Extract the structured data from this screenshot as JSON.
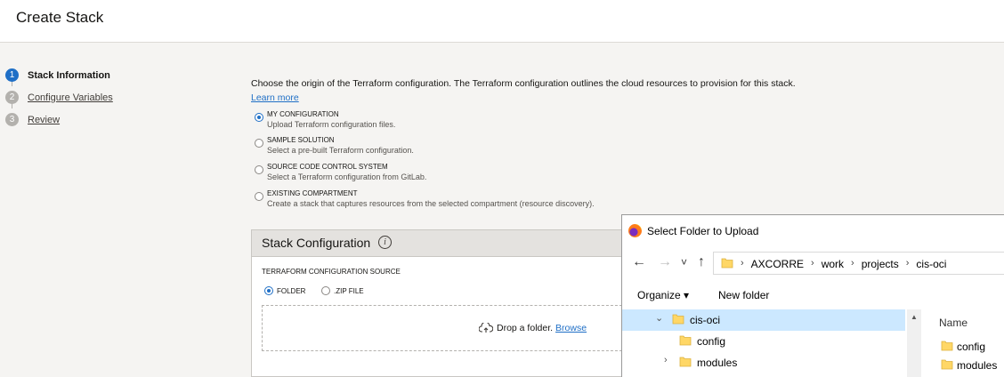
{
  "page": {
    "title": "Create Stack"
  },
  "steps": [
    {
      "num": "1",
      "label": "Stack Information",
      "active": true
    },
    {
      "num": "2",
      "label": "Configure Variables",
      "active": false
    },
    {
      "num": "3",
      "label": "Review",
      "active": false
    }
  ],
  "intro": {
    "text": "Choose the origin of the Terraform configuration. The Terraform configuration outlines the cloud resources to provision for this stack.",
    "learn_more": "Learn more"
  },
  "origin_options": [
    {
      "title": "MY CONFIGURATION",
      "desc": "Upload Terraform configuration files.",
      "selected": true
    },
    {
      "title": "SAMPLE SOLUTION",
      "desc": "Select a pre-built Terraform configuration.",
      "selected": false
    },
    {
      "title": "SOURCE CODE CONTROL SYSTEM",
      "desc": "Select a Terraform configuration from GitLab.",
      "selected": false
    },
    {
      "title": "EXISTING COMPARTMENT",
      "desc": "Create a stack that captures resources from the selected compartment (resource discovery).",
      "selected": false
    }
  ],
  "stack_config": {
    "title": "Stack Configuration",
    "info_icon": "i",
    "source_label": "TERRAFORM CONFIGURATION SOURCE",
    "source_options": [
      {
        "label": "FOLDER",
        "selected": true
      },
      {
        "label": ".ZIP FILE",
        "selected": false
      }
    ],
    "drop_text": "Drop a folder.",
    "browse": "Browse"
  },
  "dialog": {
    "title": "Select Folder to Upload",
    "nav": {
      "back": "←",
      "forward": "→",
      "recent": "˅",
      "up": "↑"
    },
    "breadcrumb": [
      "AXCORRE",
      "work",
      "projects",
      "cis-oci"
    ],
    "crumb_sep": "›",
    "organize": "Organize ▾",
    "new_folder": "New folder",
    "tree": [
      {
        "name": "cis-oci",
        "expanded": true,
        "selected": true
      },
      {
        "name": "config",
        "expanded": false,
        "selected": false
      },
      {
        "name": "modules",
        "expanded": false,
        "selected": false
      }
    ],
    "column_header": "Name",
    "files": [
      "config",
      "modules"
    ]
  },
  "colors": {
    "accent": "#1f6fc6",
    "folder": "#ffd766",
    "selection": "#cce8ff"
  }
}
